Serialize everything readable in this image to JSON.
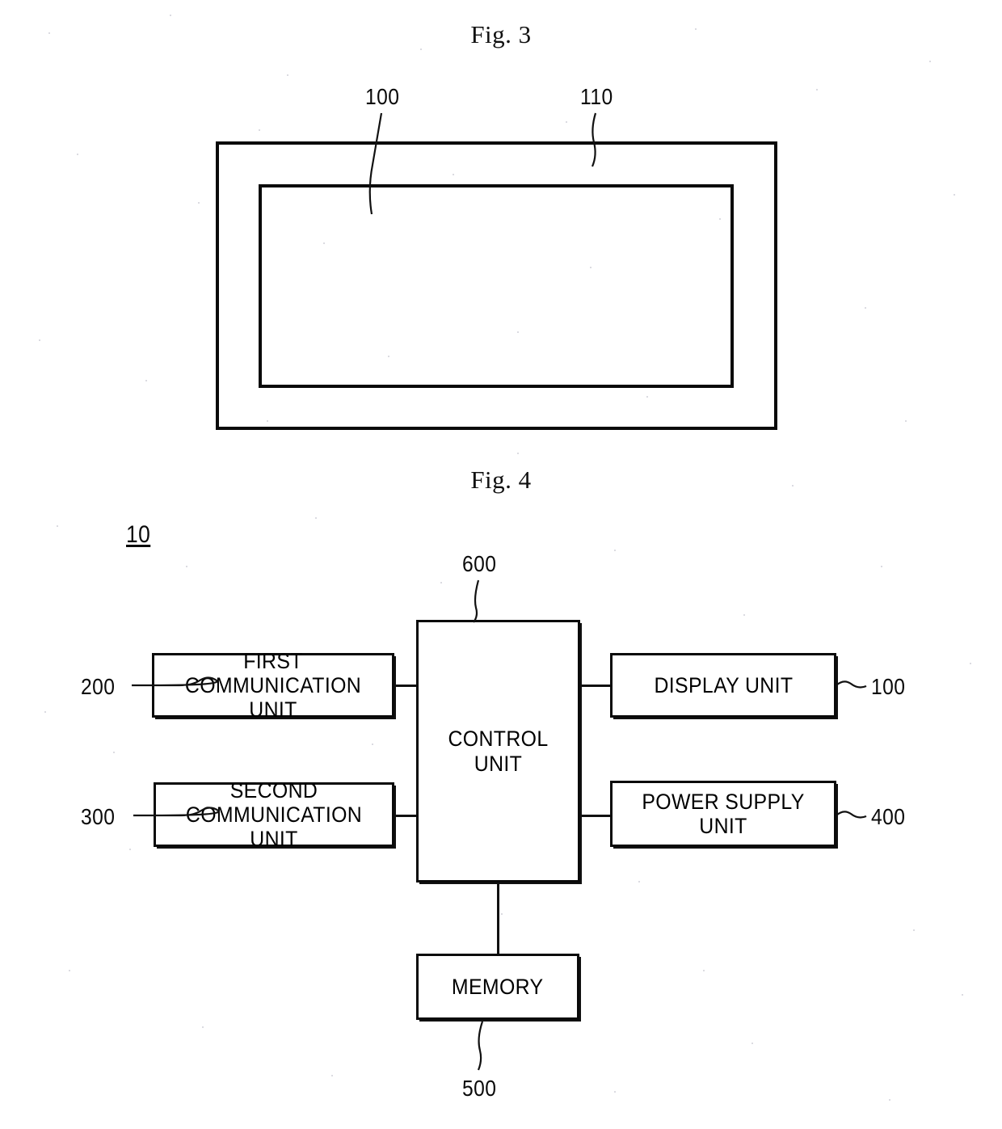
{
  "figures": [
    {
      "id": "fig3",
      "title": "Fig. 3",
      "callouts": [
        {
          "id": "fig3-ref-100",
          "text": "100"
        },
        {
          "id": "fig3-ref-110",
          "text": "110"
        }
      ],
      "shapes": [
        {
          "id": "outer-display-frame",
          "name": "display-outer-frame"
        },
        {
          "id": "inner-display-area",
          "name": "display-inner-area"
        }
      ]
    },
    {
      "id": "fig4",
      "title": "Fig. 4",
      "system_ref": "10",
      "nodes": [
        {
          "id": "first-communication-unit",
          "label": "FIRST\nCOMMUNICATION UNIT",
          "ref": "200"
        },
        {
          "id": "second-communication-unit",
          "label": "SECOND\nCOMMUNICATION UNIT",
          "ref": "300"
        },
        {
          "id": "control-unit",
          "label": "CONTROL UNIT",
          "ref": "600"
        },
        {
          "id": "display-unit",
          "label": "DISPLAY UNIT",
          "ref": "100"
        },
        {
          "id": "power-supply-unit",
          "label": "POWER SUPPLY UNIT",
          "ref": "400"
        },
        {
          "id": "memory-unit",
          "label": "MEMORY",
          "ref": "500"
        }
      ]
    }
  ],
  "fig3": {
    "title": "Fig. 3",
    "ref_100": "100",
    "ref_110": "110"
  },
  "fig4": {
    "title": "Fig. 4",
    "system_ref": "10",
    "labels": {
      "first_communication_unit": "FIRST\nCOMMUNICATION UNIT",
      "second_communication_unit": "SECOND\nCOMMUNICATION UNIT",
      "control_unit": "CONTROL UNIT",
      "display_unit": "DISPLAY UNIT",
      "power_supply_unit": "POWER SUPPLY UNIT",
      "memory": "MEMORY"
    },
    "refs": {
      "first_communication_unit": "200",
      "second_communication_unit": "300",
      "control_unit": "600",
      "display_unit": "100",
      "power_supply_unit": "400",
      "memory": "500"
    }
  },
  "colors": {
    "ink": "#0a0a0a",
    "paper": "#ffffff"
  }
}
